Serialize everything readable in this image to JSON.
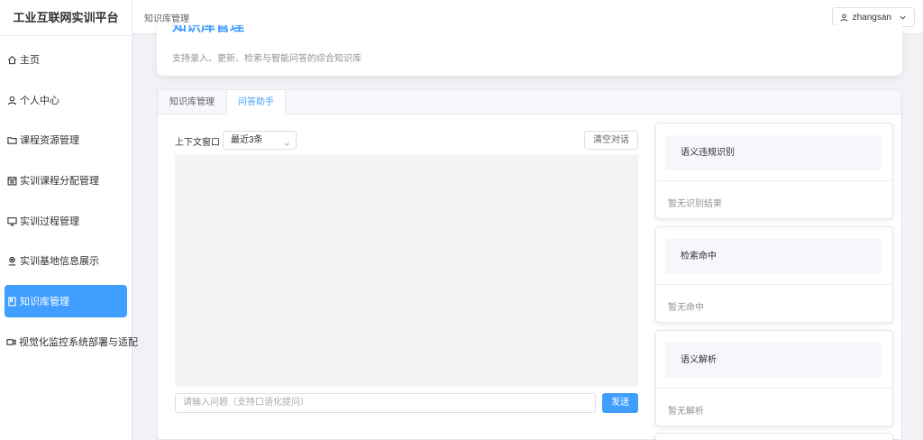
{
  "app": {
    "title": "工业互联网实训平台"
  },
  "sidebar": {
    "items": [
      {
        "label": "主页",
        "icon": "home-icon"
      },
      {
        "label": "个人中心",
        "icon": "user-icon"
      },
      {
        "label": "课程资源管理",
        "icon": "folder-icon"
      },
      {
        "label": "实训课程分配管理",
        "icon": "calendar-icon"
      },
      {
        "label": "实训过程管理",
        "icon": "monitor-icon"
      },
      {
        "label": "实训基地信息展示",
        "icon": "location-icon"
      },
      {
        "label": "知识库管理",
        "icon": "notebook-icon",
        "active": true
      },
      {
        "label": "视觉化监控系统部署与适配",
        "icon": "camera-icon"
      }
    ]
  },
  "header": {
    "breadcrumb": "知识库管理",
    "user": "zhangsan"
  },
  "banner": {
    "title": "知识库管理",
    "subtitle": "支持录入、更新、检索与智能问答的综合知识库"
  },
  "tabs": [
    {
      "label": "知识库管理"
    },
    {
      "label": "问答助手",
      "active": true
    }
  ],
  "chat": {
    "context_label": "上下文窗口",
    "context_value": "最近3条",
    "clear_label": "清空对话",
    "input_placeholder": "请输入问题（支持口语化提问）",
    "send_label": "发送"
  },
  "side_cards": [
    {
      "title": "语义违规识别",
      "body": "暂无识别结果"
    },
    {
      "title": "检索命中",
      "body": "暂无命中"
    },
    {
      "title": "语义解析",
      "body": "暂无解析"
    }
  ],
  "colors": {
    "accent": "#409eff",
    "sidebar_bg": "#ffffff",
    "page_bg": "#f0f2f5"
  }
}
